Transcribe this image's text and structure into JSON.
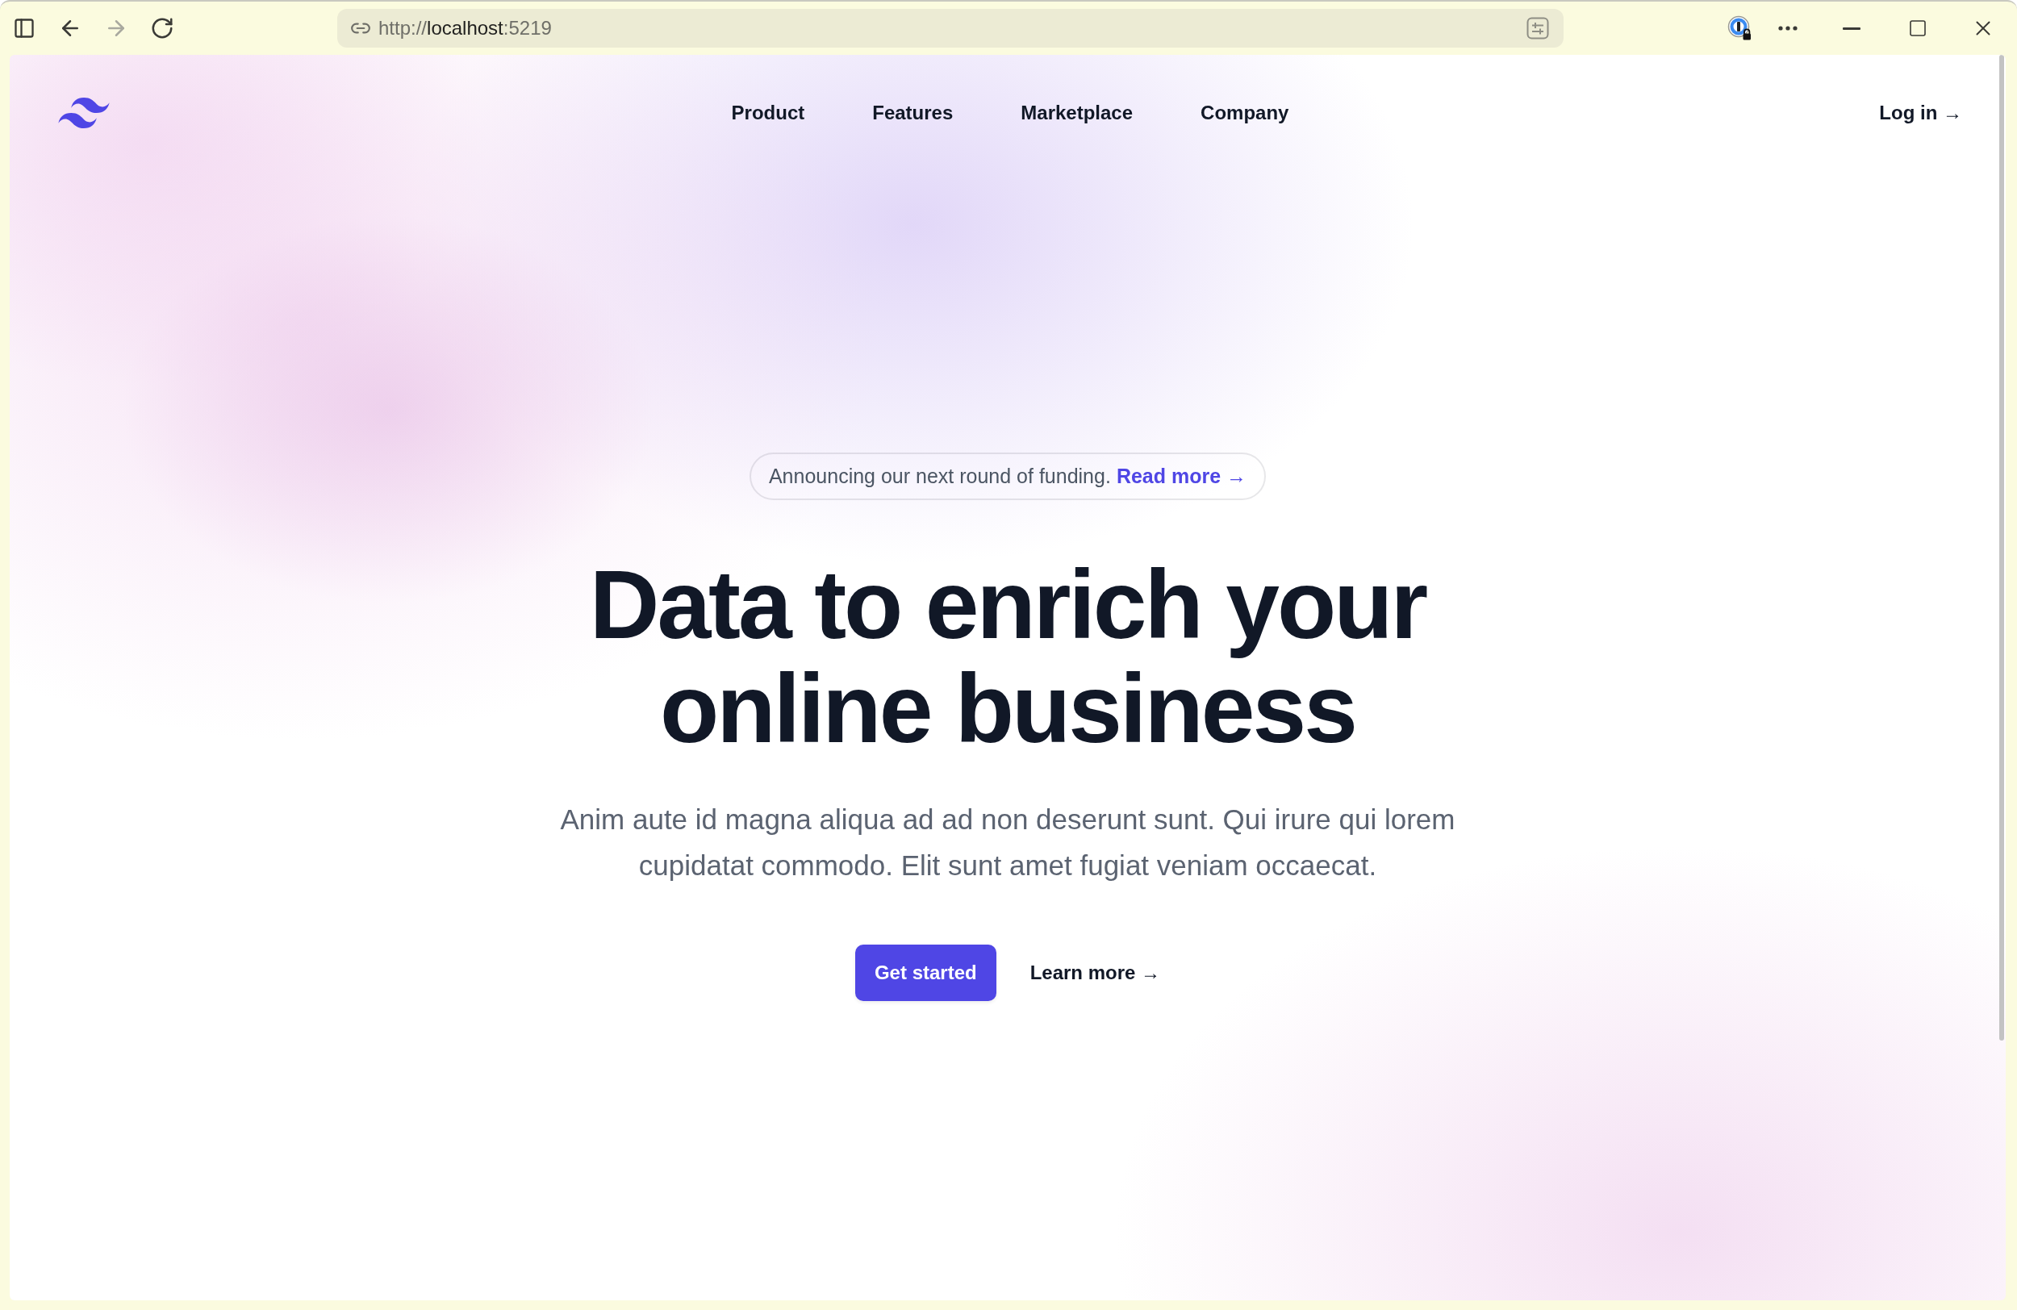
{
  "browser": {
    "nav_buttons": [
      {
        "kind": "back",
        "disabled": false
      },
      {
        "kind": "forward",
        "disabled": true
      },
      {
        "kind": "reload",
        "disabled": false
      }
    ],
    "url": {
      "scheme": "http://",
      "host": "localhost",
      "port": ":5219"
    }
  },
  "header": {
    "nav_links": [
      "Product",
      "Features",
      "Marketplace",
      "Company"
    ],
    "login": "Log in →"
  },
  "announcement": {
    "text": "Announcing our next round of funding.",
    "link": "Read more →"
  },
  "hero": {
    "title": "Data to enrich your online business",
    "description": "Anim aute id magna aliqua ad ad non deserunt sunt. Qui irure qui lorem cupidatat commodo. Elit sunt amet fugiat veniam occaecat.",
    "primary_button": "Get started",
    "secondary_link": "Learn more →"
  }
}
